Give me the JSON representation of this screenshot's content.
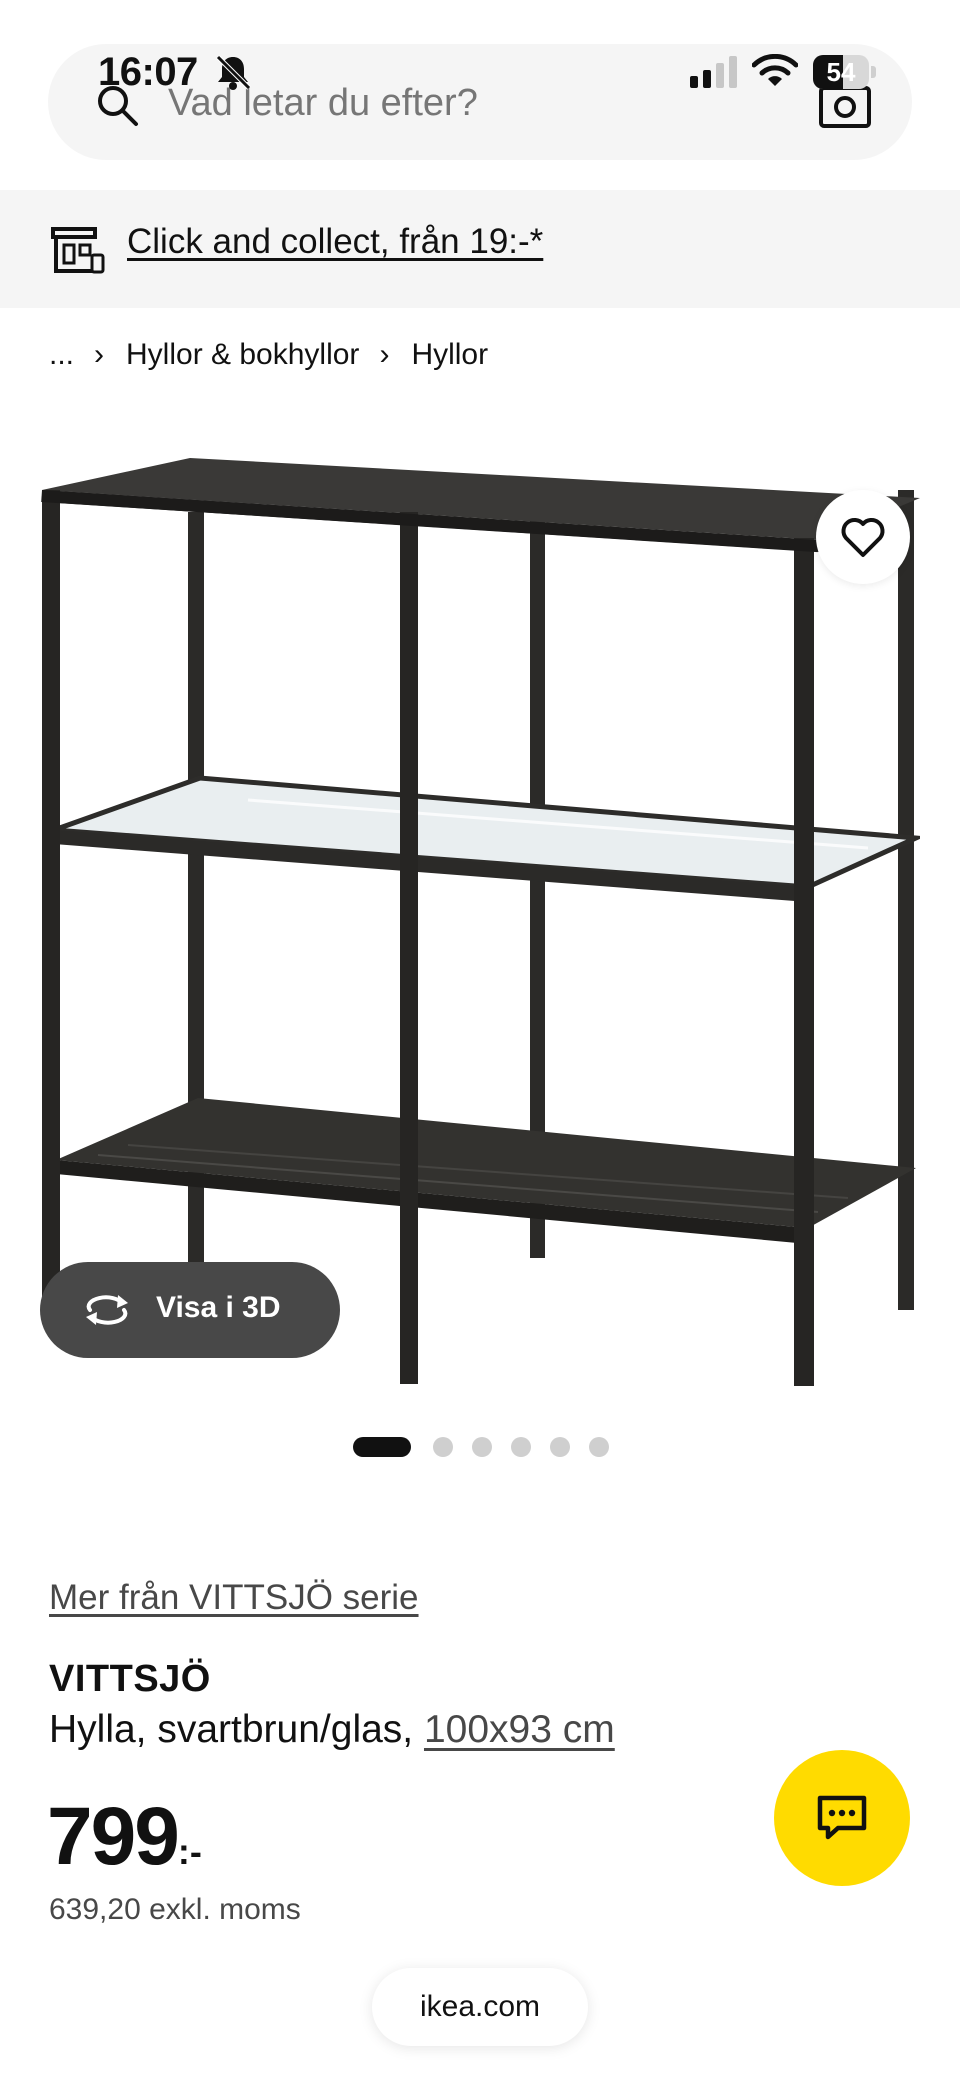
{
  "status_bar": {
    "time": "16:07",
    "battery_level": "54",
    "icons": [
      "bell-slash-icon",
      "signal-icon",
      "wifi-icon",
      "battery-icon"
    ]
  },
  "search": {
    "placeholder": "Vad letar du efter?",
    "icons": [
      "search-icon",
      "camera-icon"
    ]
  },
  "click_collect": {
    "label": "Click and collect, från 19:-*",
    "icon": "store-icon"
  },
  "breadcrumb": {
    "items": [
      "...",
      "Hyllor & bokhyllor",
      "Hyllor"
    ]
  },
  "gallery": {
    "view_3d_label": "Visa i 3D",
    "image_count": 6,
    "active_index": 0,
    "icons": [
      "heart-icon",
      "rotate-3d-icon"
    ]
  },
  "product": {
    "series_link": "Mer från VITTSJÖ serie",
    "name": "VITTSJÖ",
    "description": "Hylla, svartbrun/glas,",
    "size": "100x93 cm",
    "price": "799",
    "price_suffix": ":-",
    "price_excl_vat": "639,20 exkl. moms"
  },
  "chat": {
    "icon": "chat-icon"
  },
  "browser": {
    "url": "ikea.com"
  },
  "colors": {
    "brand_yellow": "#ffdb00",
    "surface_grey": "#f5f5f5",
    "button_dark": "#484848",
    "text": "#111111"
  }
}
